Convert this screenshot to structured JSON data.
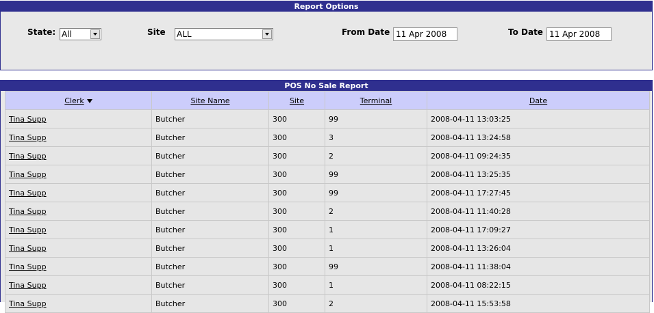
{
  "options": {
    "title": "Report Options",
    "state_label": "State:",
    "state_value": "All",
    "site_label": "Site",
    "site_value": "ALL",
    "from_label": "From Date",
    "from_value": "11 Apr 2008",
    "to_label": "To Date",
    "to_value": "11 Apr 2008"
  },
  "report": {
    "title": "POS No Sale Report",
    "columns": [
      "Clerk",
      "Site Name",
      "Site",
      "Terminal",
      "Date"
    ],
    "sort_icon": "chevron-down-icon",
    "rows": [
      [
        "Tina Supp",
        "Butcher",
        "300",
        "99",
        "2008-04-11 13:03:25"
      ],
      [
        "Tina Supp",
        "Butcher",
        "300",
        "3",
        "2008-04-11 13:24:58"
      ],
      [
        "Tina Supp",
        "Butcher",
        "300",
        "2",
        "2008-04-11 09:24:35"
      ],
      [
        "Tina Supp",
        "Butcher",
        "300",
        "99",
        "2008-04-11 13:25:35"
      ],
      [
        "Tina Supp",
        "Butcher",
        "300",
        "99",
        "2008-04-11 17:27:45"
      ],
      [
        "Tina Supp",
        "Butcher",
        "300",
        "2",
        "2008-04-11 11:40:28"
      ],
      [
        "Tina Supp",
        "Butcher",
        "300",
        "1",
        "2008-04-11 17:09:27"
      ],
      [
        "Tina Supp",
        "Butcher",
        "300",
        "1",
        "2008-04-11 13:26:04"
      ],
      [
        "Tina Supp",
        "Butcher",
        "300",
        "99",
        "2008-04-11 11:38:04"
      ],
      [
        "Tina Supp",
        "Butcher",
        "300",
        "1",
        "2008-04-11 08:22:15"
      ],
      [
        "Tina Supp",
        "Butcher",
        "300",
        "2",
        "2008-04-11 15:53:58"
      ]
    ]
  }
}
